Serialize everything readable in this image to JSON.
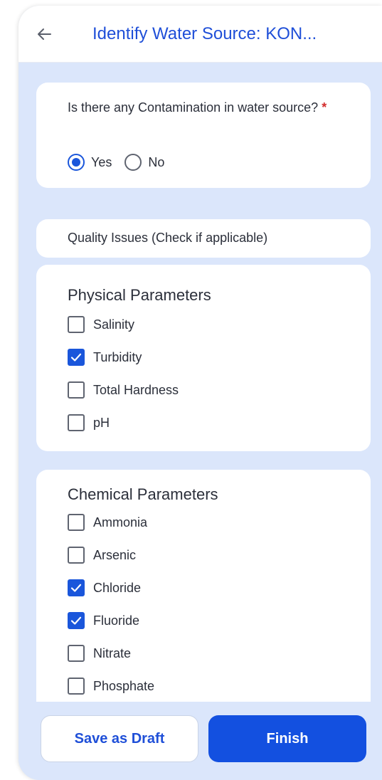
{
  "header": {
    "title": "Identify Water Source: KON...",
    "back_icon": "arrow-left-icon"
  },
  "contamination": {
    "question": "Is there any Contamination in water source?",
    "required_marker": "*",
    "options": [
      {
        "label": "Yes",
        "selected": true
      },
      {
        "label": "No",
        "selected": false
      }
    ]
  },
  "quality_issues": {
    "label": "Quality Issues (Check if applicable)"
  },
  "physical": {
    "title": "Physical Parameters",
    "items": [
      {
        "label": "Salinity",
        "checked": false
      },
      {
        "label": "Turbidity",
        "checked": true
      },
      {
        "label": "Total Hardness",
        "checked": false
      },
      {
        "label": "pH",
        "checked": false
      }
    ]
  },
  "chemical": {
    "title": "Chemical Parameters",
    "items": [
      {
        "label": "Ammonia",
        "checked": false
      },
      {
        "label": "Arsenic",
        "checked": false
      },
      {
        "label": "Chloride",
        "checked": true
      },
      {
        "label": "Fluoride",
        "checked": true
      },
      {
        "label": "Nitrate",
        "checked": false
      },
      {
        "label": "Phosphate",
        "checked": false
      }
    ]
  },
  "actions": {
    "save_draft": "Save as Draft",
    "finish": "Finish"
  },
  "colors": {
    "accent": "#1a56db",
    "background": "#dbe6fb",
    "required": "#d32f2f"
  }
}
